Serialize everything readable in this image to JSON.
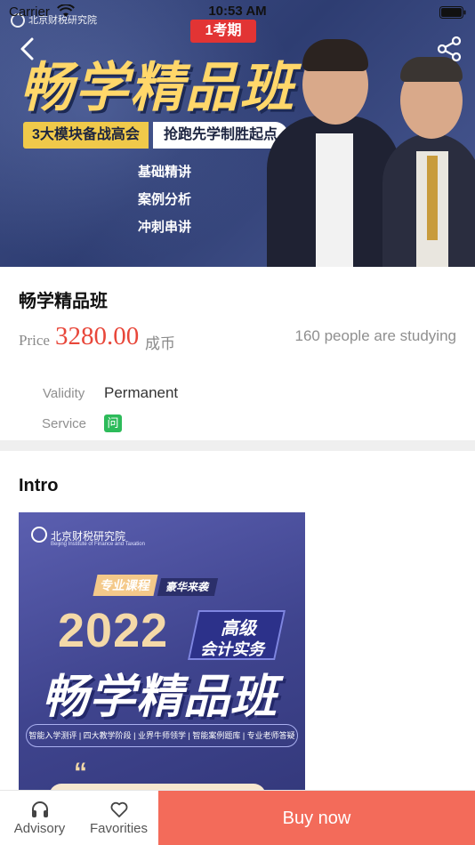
{
  "status_bar": {
    "carrier": "Carrier",
    "time": "10:53 AM"
  },
  "banner": {
    "issue_tag": "1考期",
    "title": "畅学精品班",
    "module_text": "3大模块备战高会",
    "module_text_2": "抢跑先学制胜起点",
    "list": [
      "基础精讲",
      "案例分析",
      "冲刺串讲"
    ],
    "icons": {
      "back": "chevron-left-icon",
      "share": "share-icon"
    }
  },
  "course": {
    "title": "畅学精品班",
    "price_label": "Price",
    "price_value": "3280.00",
    "price_unit": "成币",
    "study_count": "160 people are studying",
    "validity_label": "Validity",
    "validity_value": "Permanent",
    "service_label": "Service",
    "service_badge": "问"
  },
  "intro": {
    "title": "Intro",
    "poster": {
      "logo": "北京财税研究院",
      "logo_sub": "Beijing Institute of Finance and Taxation",
      "tag1": "专业课程",
      "tag2": "豪华来袭",
      "year": "2022",
      "box_line1": "高级",
      "box_line2": "会计实务",
      "title": "畅学精品班",
      "features": "智能入学测评 | 四大教学阶段 | 业界牛师领学 | 智能案例题库 | 专业老师答疑",
      "quote": "“"
    }
  },
  "bottom_bar": {
    "advisory_label": "Advisory",
    "favorites_label": "Favorities",
    "buy_label": "Buy now",
    "icons": {
      "advisory": "headphones-icon",
      "favorites": "heart-icon"
    }
  },
  "colors": {
    "accent": "#f36b5a",
    "price": "#e8473a",
    "service_badge": "#2dbb5a"
  }
}
